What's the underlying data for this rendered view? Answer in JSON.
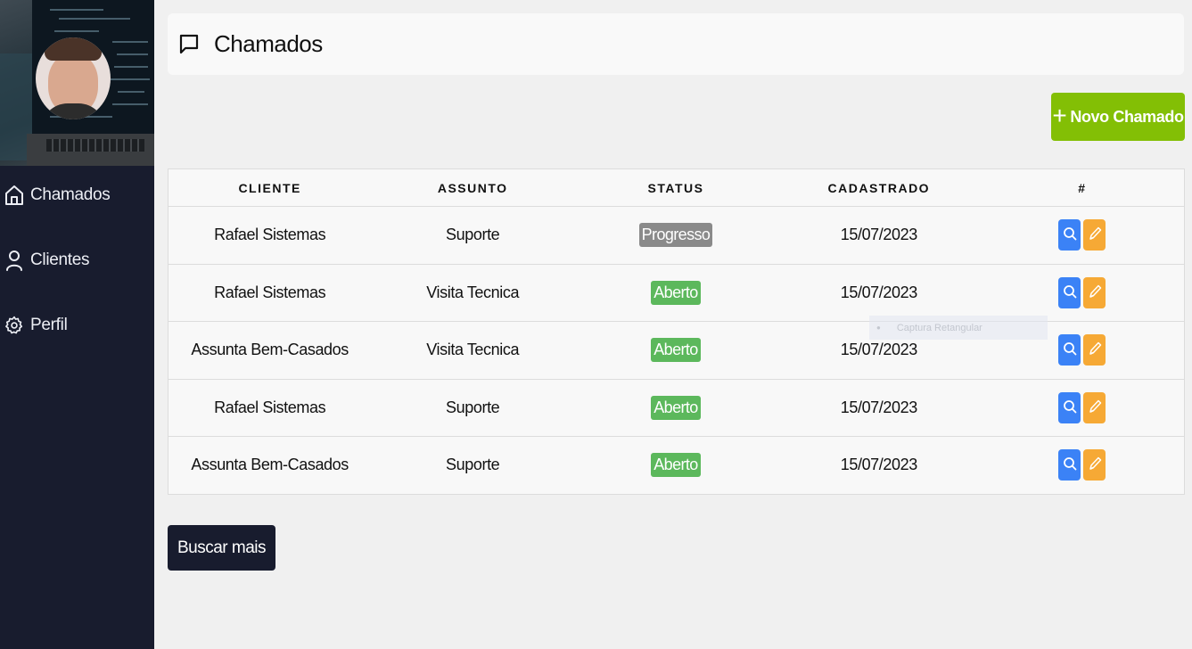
{
  "sidebar": {
    "items": [
      {
        "label": "Chamados",
        "icon": "home-icon"
      },
      {
        "label": "Clientes",
        "icon": "user-icon"
      },
      {
        "label": "Perfil",
        "icon": "gear-icon"
      }
    ]
  },
  "header": {
    "title": "Chamados",
    "icon": "message-icon"
  },
  "toolbar": {
    "new_label": "Novo Chamado",
    "new_icon": "plus-icon",
    "accent": "#83bf05"
  },
  "table": {
    "columns": [
      "CLIENTE",
      "ASSUNTO",
      "STATUS",
      "CADASTRADO",
      "#"
    ],
    "rows": [
      {
        "cliente": "Rafael Sistemas",
        "assunto": "Suporte",
        "status": "Progresso",
        "status_color": "#8a8a8a",
        "cadastrado": "15/07/2023"
      },
      {
        "cliente": "Rafael Sistemas",
        "assunto": "Visita Tecnica",
        "status": "Aberto",
        "status_color": "#5cb85c",
        "cadastrado": "15/07/2023"
      },
      {
        "cliente": "Assunta Bem-Casados",
        "assunto": "Visita Tecnica",
        "status": "Aberto",
        "status_color": "#5cb85c",
        "cadastrado": "15/07/2023"
      },
      {
        "cliente": "Rafael Sistemas",
        "assunto": "Suporte",
        "status": "Aberto",
        "status_color": "#5cb85c",
        "cadastrado": "15/07/2023"
      },
      {
        "cliente": "Assunta Bem-Casados",
        "assunto": "Suporte",
        "status": "Aberto",
        "status_color": "#5cb85c",
        "cadastrado": "15/07/2023"
      }
    ],
    "actions": {
      "view_icon": "search-icon",
      "view_color": "#3b82f6",
      "edit_icon": "edit-icon",
      "edit_color": "#f6a935"
    }
  },
  "footer": {
    "more_label": "Buscar mais"
  },
  "overlay": {
    "tooltip_text": "Captura Retangular"
  }
}
